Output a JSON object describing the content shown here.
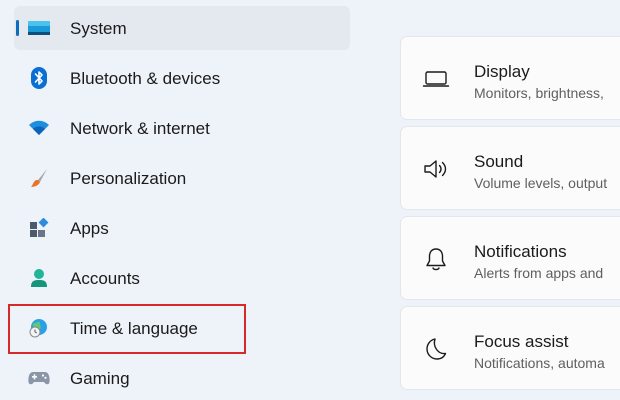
{
  "nav": {
    "items": [
      {
        "label": "System",
        "icon": "monitor-icon",
        "selected": true
      },
      {
        "label": "Bluetooth & devices",
        "icon": "bluetooth-icon"
      },
      {
        "label": "Network & internet",
        "icon": "wifi-icon"
      },
      {
        "label": "Personalization",
        "icon": "paintbrush-icon"
      },
      {
        "label": "Apps",
        "icon": "apps-icon"
      },
      {
        "label": "Accounts",
        "icon": "person-icon"
      },
      {
        "label": "Time & language",
        "icon": "globe-clock-icon",
        "highlighted": true
      },
      {
        "label": "Gaming",
        "icon": "gamepad-icon"
      }
    ]
  },
  "settings": {
    "cards": [
      {
        "title": "Display",
        "subtitle": "Monitors, brightness,",
        "icon": "laptop-icon"
      },
      {
        "title": "Sound",
        "subtitle": "Volume levels, output",
        "icon": "speaker-icon"
      },
      {
        "title": "Notifications",
        "subtitle": "Alerts from apps and",
        "icon": "bell-icon"
      },
      {
        "title": "Focus assist",
        "subtitle": "Notifications, automa",
        "icon": "moon-icon"
      }
    ]
  },
  "colors": {
    "background": "#eef2f9",
    "selected_background": "#e4e8ef",
    "accent": "#0f6cbd",
    "highlight_border": "#d62a2a",
    "card_background": "#fbfbfc"
  }
}
